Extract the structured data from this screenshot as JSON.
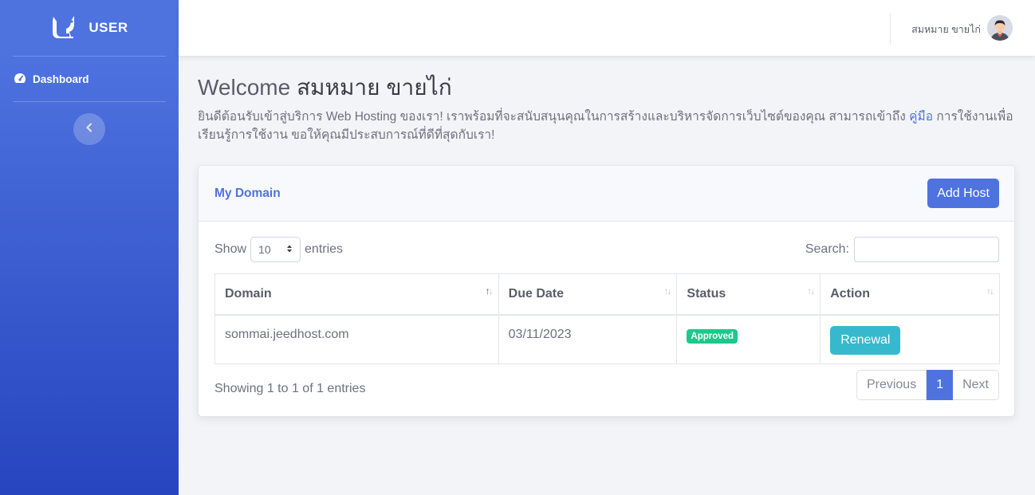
{
  "sidebar": {
    "brand": "USER",
    "nav_items": [
      {
        "label": "Dashboard",
        "icon": "tachometer-icon"
      }
    ],
    "toggle_icon": "chevron-left-icon"
  },
  "topbar": {
    "user_name": "สมหมาย ขายไก่"
  },
  "main": {
    "welcome_prefix": "Welcome",
    "welcome_name": "สมหมาย ขายไก่",
    "intro_before_link": "ยินดีต้อนรับเข้าสู่บริการ Web Hosting ของเรา! เราพร้อมที่จะสนับสนุนคุณในการสร้างและบริหารจัดการเว็บไซต์ของคุณ สามารถเข้าถึง ",
    "intro_link": "คู่มือ",
    "intro_after_link": " การใช้งานเพื่อเรียนรู้การใช้งาน ขอให้คุณมีประสบการณ์ที่ดีที่สุดกับเรา!"
  },
  "card": {
    "title": "My Domain",
    "add_button": "Add Host",
    "show_label": "Show",
    "entries_value": "10",
    "entries_label": "entries",
    "search_label": "Search:",
    "columns": [
      "Domain",
      "Due Date",
      "Status",
      "Action"
    ],
    "rows": [
      {
        "domain": "sommai.jeedhost.com",
        "due_date": "03/11/2023",
        "status": "Approved",
        "action": "Renewal"
      }
    ],
    "info": "Showing 1 to 1 of 1 entries",
    "pagination": {
      "previous": "Previous",
      "current": "1",
      "next": "Next"
    }
  },
  "colors": {
    "primary": "#4e73df",
    "success": "#1cc88a",
    "info": "#36b9cc"
  }
}
